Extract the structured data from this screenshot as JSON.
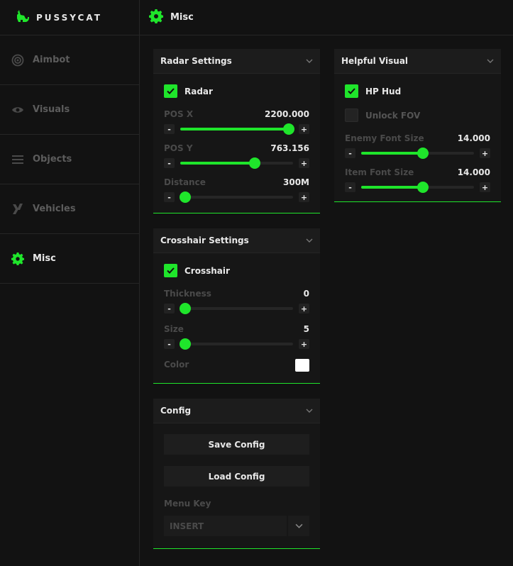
{
  "app": {
    "name": "PUSSYCAT"
  },
  "sidebar": {
    "items": [
      {
        "label": "Aimbot",
        "icon": "target-icon"
      },
      {
        "label": "Visuals",
        "icon": "eye-icon"
      },
      {
        "label": "Objects",
        "icon": "menu-icon"
      },
      {
        "label": "Vehicles",
        "icon": "x-logo-icon"
      },
      {
        "label": "Misc",
        "icon": "gear-icon",
        "active": true
      }
    ]
  },
  "header": {
    "title": "Misc"
  },
  "colors": {
    "accent": "#1fe52b",
    "background": "#121212",
    "panel": "#161616"
  },
  "radar": {
    "title": "Radar Settings",
    "checkbox": {
      "label": "Radar",
      "checked": true
    },
    "pos_x": {
      "label": "POS X",
      "value": "2200.000",
      "fraction": 0.96
    },
    "pos_y": {
      "label": "POS Y",
      "value": "763.156",
      "fraction": 0.66
    },
    "distance": {
      "label": "Distance",
      "value": "300M",
      "fraction": 0.0
    }
  },
  "crosshair": {
    "title": "Crosshair Settings",
    "checkbox": {
      "label": "Crosshair",
      "checked": true
    },
    "thickness": {
      "label": "Thickness",
      "value": "0",
      "fraction": 0.0
    },
    "size": {
      "label": "Size",
      "value": "5",
      "fraction": 0.0
    },
    "color": {
      "label": "Color",
      "value": "#ffffff"
    }
  },
  "config": {
    "title": "Config",
    "save_label": "Save Config",
    "load_label": "Load Config",
    "menu_key_label": "Menu Key",
    "menu_key_value": "INSERT"
  },
  "helpful": {
    "title": "Helpful Visual",
    "hp_hud": {
      "label": "HP Hud",
      "checked": true
    },
    "unlock_fov": {
      "label": "Unlock FOV",
      "checked": false
    },
    "enemy_font": {
      "label": "Enemy Font Size",
      "value": "14.000",
      "fraction": 0.55
    },
    "item_font": {
      "label": "Item Font Size",
      "value": "14.000",
      "fraction": 0.55
    }
  },
  "stepper": {
    "minus": "-",
    "plus": "+"
  }
}
